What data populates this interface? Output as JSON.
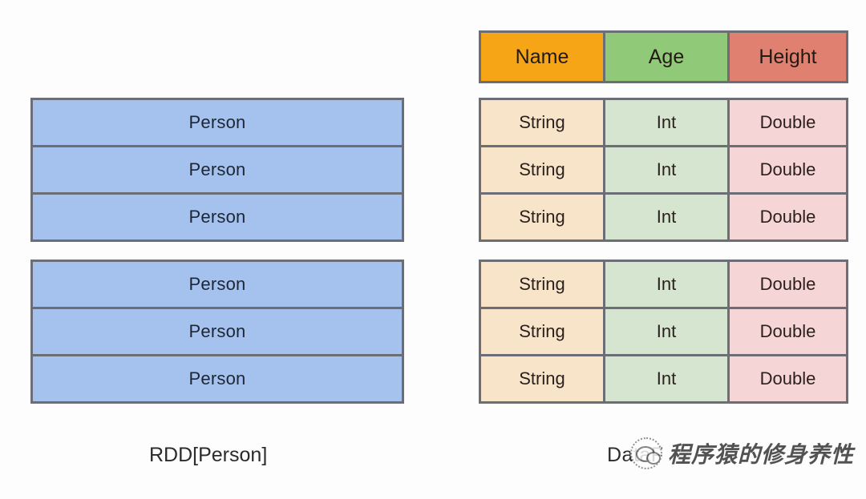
{
  "diagram": {
    "rdd": {
      "caption": "RDD[Person]",
      "groups": [
        {
          "rows": [
            "Person",
            "Person",
            "Person"
          ]
        },
        {
          "rows": [
            "Person",
            "Person",
            "Person"
          ]
        }
      ]
    },
    "dataframe": {
      "caption": "DataF",
      "header": [
        "Name",
        "Age",
        "Height"
      ],
      "groups": [
        {
          "rows": [
            [
              "String",
              "Int",
              "Double"
            ],
            [
              "String",
              "Int",
              "Double"
            ],
            [
              "String",
              "Int",
              "Double"
            ]
          ]
        },
        {
          "rows": [
            [
              "String",
              "Int",
              "Double"
            ],
            [
              "String",
              "Int",
              "Double"
            ],
            [
              "String",
              "Int",
              "Double"
            ]
          ]
        }
      ]
    }
  },
  "watermark": {
    "text": "程序猿的修身养性",
    "logo": "wechat-official-account-icon"
  },
  "colors": {
    "header_name": "#f5a516",
    "header_age": "#90c978",
    "header_height": "#e08070",
    "cell_string": "#f8e4c8",
    "cell_int": "#d5e5d0",
    "cell_double": "#f5d5d5",
    "rdd_block": "#a5c2ee",
    "border": "#6b6f75",
    "background": "#fdfdfd"
  }
}
